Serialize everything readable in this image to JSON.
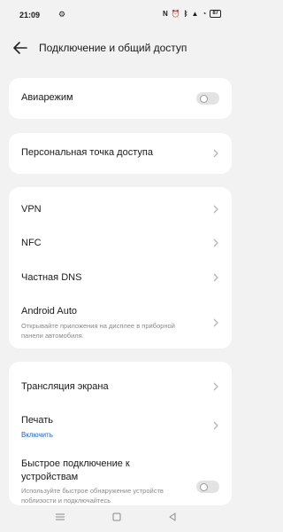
{
  "status": {
    "time": "21:09",
    "battery": "87"
  },
  "header": {
    "title": "Подключение и общий доступ"
  },
  "items": {
    "airplane": "Авиарежим",
    "hotspot": "Персональная точка доступа",
    "vpn": "VPN",
    "nfc": "NFC",
    "private_dns": "Частная DNS",
    "android_auto": "Android Auto",
    "android_auto_sub": "Открывайте приложения на дисплее в приборной панели автомобиля.",
    "cast": "Трансляция экрана",
    "print": "Печать",
    "print_status": "Включить",
    "quick_connect": "Быстрое подключение к устройствам",
    "quick_connect_sub": "Используйте быстрое обнаружение устройств поблизости и подключайтесь"
  },
  "toggles": {
    "airplane_on": false,
    "quick_connect_on": false
  },
  "colors": {
    "background": "#f2f2f2",
    "card": "#ffffff",
    "link": "#2563c7"
  }
}
